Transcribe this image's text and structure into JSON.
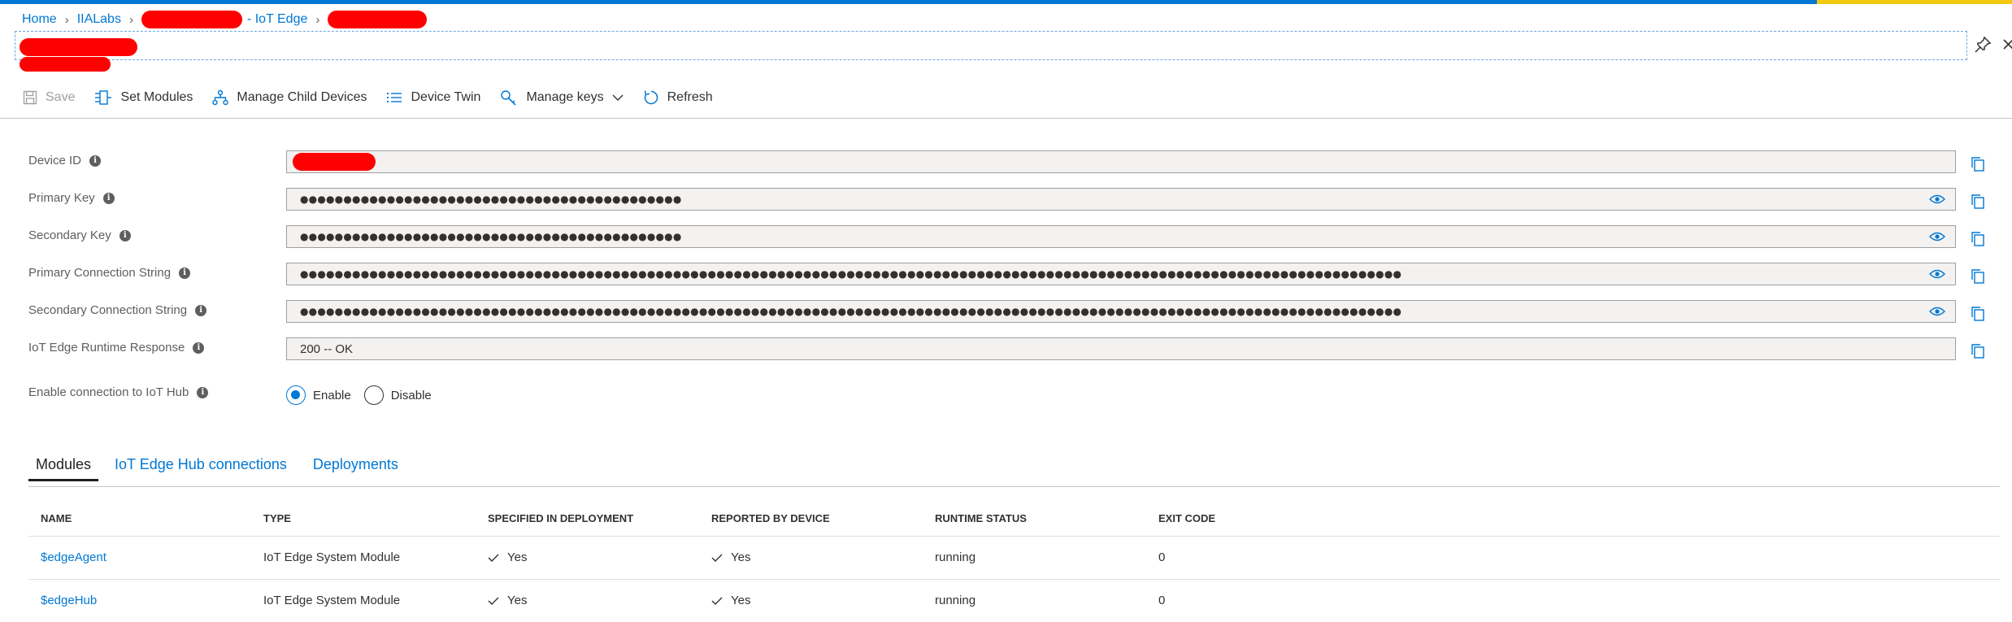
{
  "breadcrumb": {
    "home": "Home",
    "hub": "IIALabs",
    "iot_edge": "- IoT Edge"
  },
  "toolbar": {
    "save": "Save",
    "set_modules": "Set Modules",
    "manage_child_devices": "Manage Child Devices",
    "device_twin": "Device Twin",
    "manage_keys": "Manage keys",
    "refresh": "Refresh"
  },
  "form": {
    "device_id": {
      "label": "Device ID",
      "value": ""
    },
    "primary_key": {
      "label": "Primary Key",
      "value": "●●●●●●●●●●●●●●●●●●●●●●●●●●●●●●●●●●●●●●●●●●●●"
    },
    "secondary_key": {
      "label": "Secondary Key",
      "value": "●●●●●●●●●●●●●●●●●●●●●●●●●●●●●●●●●●●●●●●●●●●●"
    },
    "primary_connection_string": {
      "label": "Primary Connection String",
      "value": "●●●●●●●●●●●●●●●●●●●●●●●●●●●●●●●●●●●●●●●●●●●●●●●●●●●●●●●●●●●●●●●●●●●●●●●●●●●●●●●●●●●●●●●●●●●●●●●●●●●●●●●●●●●●●●●●●●●●●●●●●●●●●●●"
    },
    "secondary_connection_string": {
      "label": "Secondary Connection String",
      "value": "●●●●●●●●●●●●●●●●●●●●●●●●●●●●●●●●●●●●●●●●●●●●●●●●●●●●●●●●●●●●●●●●●●●●●●●●●●●●●●●●●●●●●●●●●●●●●●●●●●●●●●●●●●●●●●●●●●●●●●●●●●●●●●●"
    },
    "runtime_response": {
      "label": "IoT Edge Runtime Response",
      "value": "200 -- OK"
    },
    "enable_connection": {
      "label": "Enable connection to IoT Hub",
      "options": [
        "Enable",
        "Disable"
      ],
      "selected": "Enable"
    }
  },
  "tabs": [
    "Modules",
    "IoT Edge Hub connections",
    "Deployments"
  ],
  "active_tab": "Modules",
  "modules_table": {
    "headers": [
      "NAME",
      "TYPE",
      "SPECIFIED IN DEPLOYMENT",
      "REPORTED BY DEVICE",
      "RUNTIME STATUS",
      "EXIT CODE"
    ],
    "rows": [
      {
        "name": "$edgeAgent",
        "type": "IoT Edge System Module",
        "specified": "Yes",
        "reported": "Yes",
        "status": "running",
        "exit_code": "0"
      },
      {
        "name": "$edgeHub",
        "type": "IoT Edge System Module",
        "specified": "Yes",
        "reported": "Yes",
        "status": "running",
        "exit_code": "0"
      }
    ]
  },
  "colors": {
    "accent": "#0078d4",
    "redaction": "#ff0000",
    "field_bg": "#f3f2f1"
  },
  "icons": [
    "save-icon",
    "set-modules-icon",
    "child-devices-icon",
    "device-twin-icon",
    "key-icon",
    "chevron-down-icon",
    "refresh-icon",
    "pin-icon",
    "close-icon",
    "info-icon",
    "eye-icon",
    "copy-icon",
    "check-icon"
  ]
}
